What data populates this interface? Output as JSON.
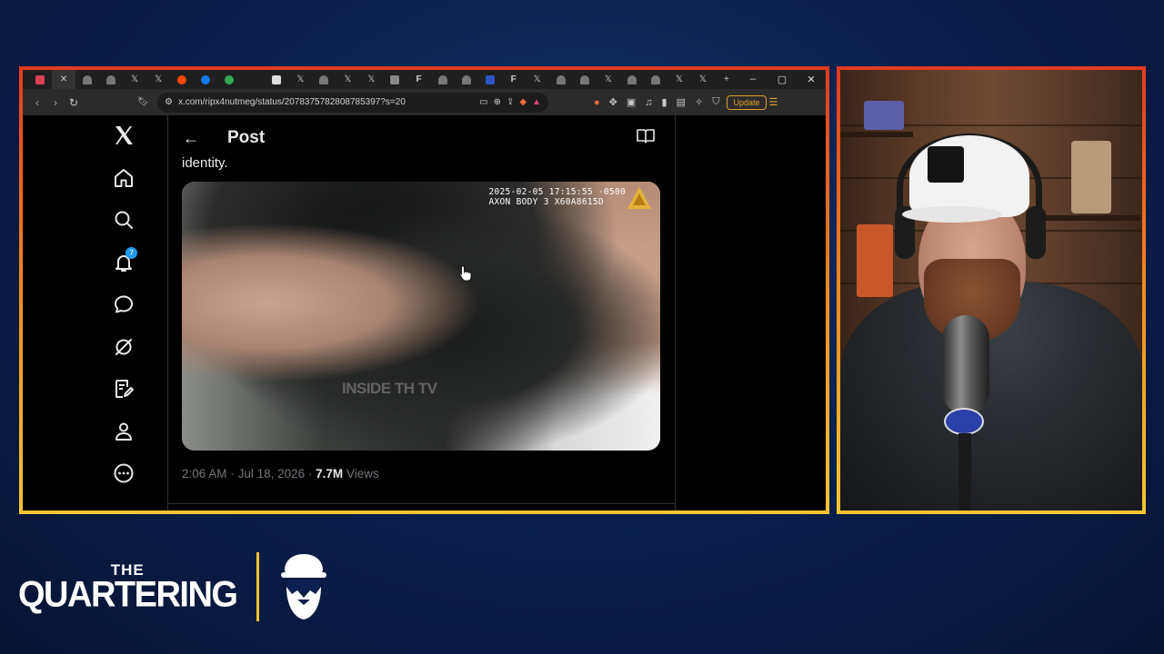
{
  "browser": {
    "tab_count": 28,
    "address_url": "x.com/ripx4nutmeg/status/2078375782808785397?s=20",
    "update_label": "Update",
    "window_controls": [
      "–",
      "▢",
      "✕"
    ],
    "new_tab_symbol": "+"
  },
  "x_app": {
    "nav": [
      {
        "name": "x-logo-icon",
        "label": "X"
      },
      {
        "name": "home-icon",
        "label": "Home"
      },
      {
        "name": "search-icon",
        "label": "Explore"
      },
      {
        "name": "bell-icon",
        "label": "Notifications"
      },
      {
        "name": "chat-icon",
        "label": "Messages"
      },
      {
        "name": "grok-icon",
        "label": "Grok"
      },
      {
        "name": "compose-icon",
        "label": "Lists"
      },
      {
        "name": "profile-icon",
        "label": "Profile"
      },
      {
        "name": "more-icon",
        "label": "More"
      }
    ],
    "notification_count": "7",
    "header": {
      "back_symbol": "←",
      "title": "Post"
    },
    "tweet": {
      "text": "identity.",
      "video": {
        "timestamp_line1": "2025-02-05 17:15:55 -0500",
        "timestamp_line2": "AXON BODY 3 X60A8615D",
        "watermark": "INSIDE TH    TV"
      },
      "time": "2:06 AM",
      "date": "Jul 18, 2026",
      "separator": "·",
      "views_count": "7.7M",
      "views_label": "Views"
    }
  },
  "brand": {
    "line1": "THE",
    "line2": "QUARTERING"
  },
  "colors": {
    "frame_top": "#e23a1e",
    "frame_bottom": "#f5c531",
    "x_blue": "#1d9bf0",
    "background": "#0b2150"
  }
}
